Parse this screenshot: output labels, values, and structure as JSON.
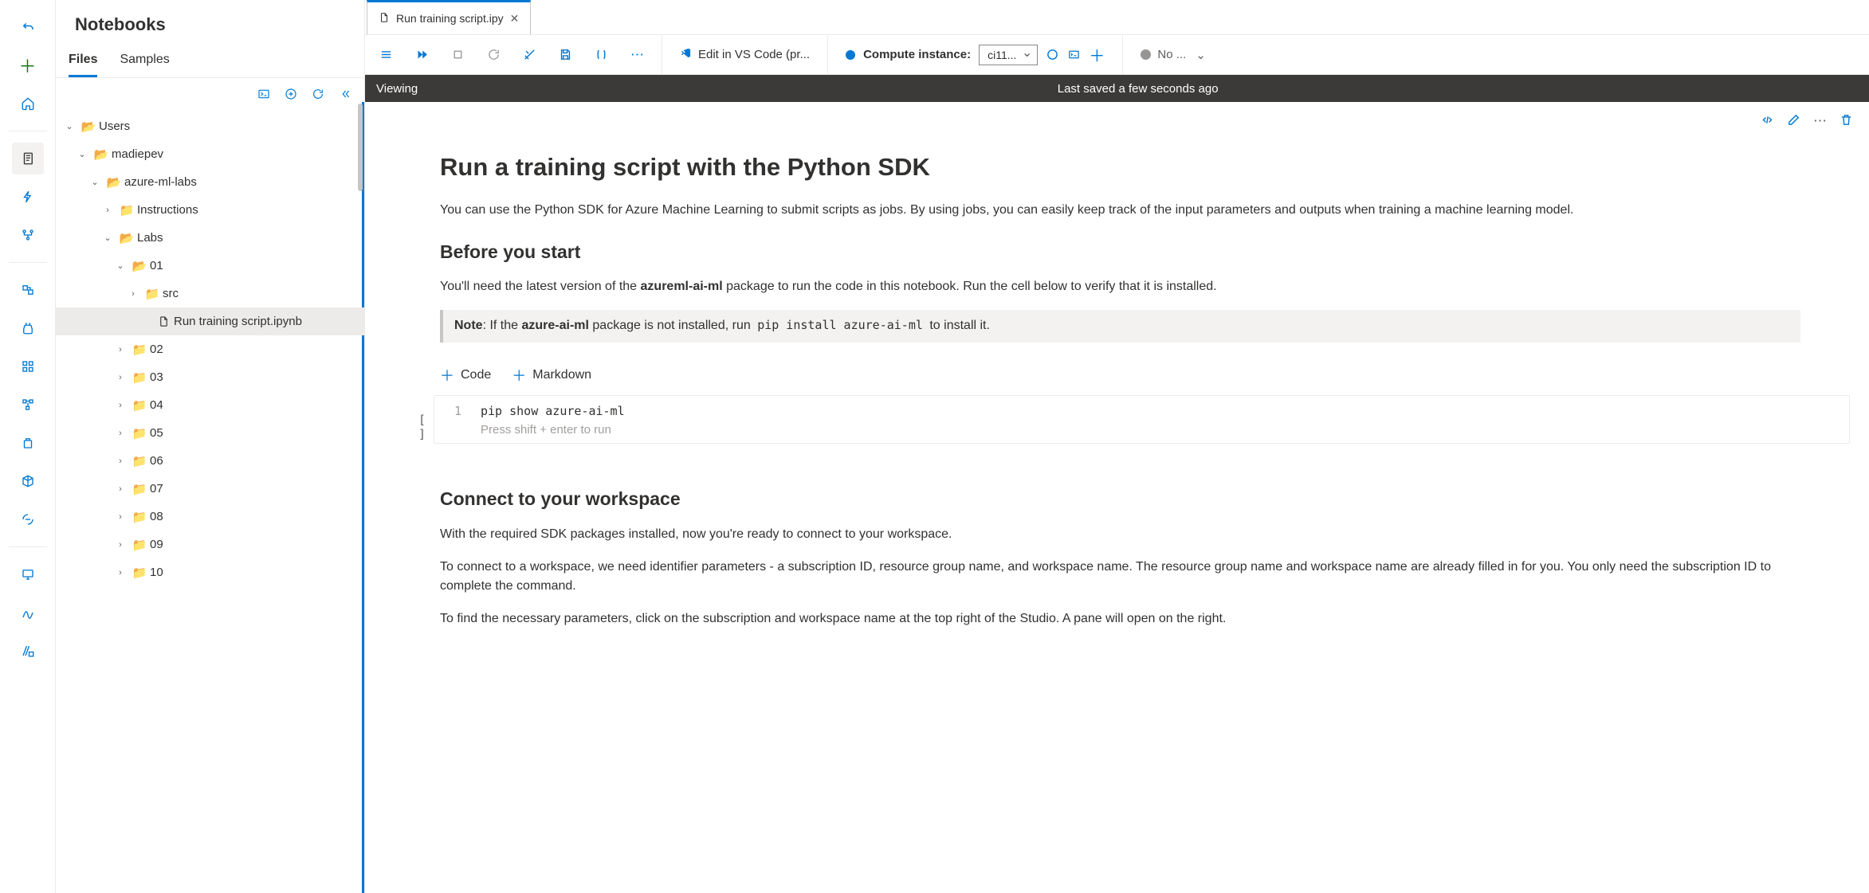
{
  "panel": {
    "title": "Notebooks",
    "tabs": {
      "files": "Files",
      "samples": "Samples"
    }
  },
  "tree": {
    "root": "Users",
    "user": "madiepev",
    "repo": "azure-ml-labs",
    "instructions": "Instructions",
    "labs": "Labs",
    "lab01": "01",
    "src": "src",
    "file": "Run training script.ipynb",
    "folders": [
      "02",
      "03",
      "04",
      "05",
      "06",
      "07",
      "08",
      "09",
      "10"
    ]
  },
  "tab": {
    "label": "Run training script.ipy"
  },
  "toolbar": {
    "vscode": "Edit in VS Code (pr...",
    "compute_label": "Compute instance:",
    "compute_value": "ci11...",
    "kernel": "No ..."
  },
  "status": {
    "mode": "Viewing",
    "saved": "Last saved a few seconds ago"
  },
  "notebook": {
    "h1": "Run a training script with the Python SDK",
    "p1": "You can use the Python SDK for Azure Machine Learning to submit scripts as jobs. By using jobs, you can easily keep track of the input parameters and outputs when training a machine learning model.",
    "h2a": "Before you start",
    "p2_a": "You'll need the latest version of the ",
    "p2_b": "azureml-ai-ml",
    "p2_c": " package to run the code in this notebook. Run the cell below to verify that it is installed.",
    "note_label": "Note",
    "note_a": ": If the ",
    "note_pkg": "azure-ai-ml",
    "note_b": " package is not installed, run ",
    "note_cmd": "pip install azure-ai-ml",
    "note_c": " to install it.",
    "insert_code": "Code",
    "insert_md": "Markdown",
    "code1": "pip show azure-ai-ml",
    "run_hint": "Press shift + enter to run",
    "exec": "[ ]",
    "h2b": "Connect to your workspace",
    "p3": "With the required SDK packages installed, now you're ready to connect to your workspace.",
    "p4": "To connect to a workspace, we need identifier parameters - a subscription ID, resource group name, and workspace name. The resource group name and workspace name are already filled in for you. You only need the subscription ID to complete the command.",
    "p5": "To find the necessary parameters, click on the subscription and workspace name at the top right of the Studio. A pane will open on the right."
  }
}
